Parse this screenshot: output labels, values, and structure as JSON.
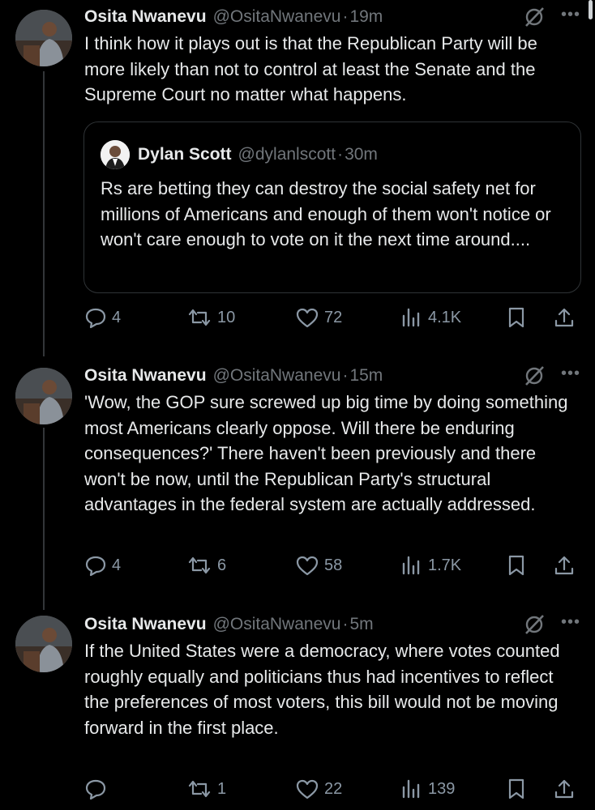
{
  "tweets": [
    {
      "author": "Osita Nwanevu",
      "handle": "@OsitaNwanevu",
      "separator": "·",
      "time": "19m",
      "text": "I think how it plays out is that the Republican Party will be more likely than not to control at least the Senate and the Supreme Court no matter what happens.",
      "quote": {
        "author": "Dylan Scott",
        "handle": "@dylanlscott",
        "separator": "·",
        "time": "30m",
        "text": "Rs are betting they can destroy the social safety net for millions of Americans and enough of them won't notice or won't care enough to vote on it the next time around...."
      },
      "replies": "4",
      "reposts": "10",
      "likes": "72",
      "views": "4.1K"
    },
    {
      "author": "Osita Nwanevu",
      "handle": "@OsitaNwanevu",
      "separator": "·",
      "time": "15m",
      "text": "'Wow, the GOP sure screwed up big time by doing something most Americans clearly oppose. Will there be enduring consequences?' There haven't been previously and there won't be now, until the Republican Party's structural advantages in the federal system are actually addressed.",
      "replies": "4",
      "reposts": "6",
      "likes": "58",
      "views": "1.7K"
    },
    {
      "author": "Osita Nwanevu",
      "handle": "@OsitaNwanevu",
      "separator": "·",
      "time": "5m",
      "text": "If the United States were a democracy, where votes counted roughly equally and politicians thus had incentives to reflect the preferences of most voters, this bill would not be moving forward in the first place.",
      "replies": "",
      "reposts": "1",
      "likes": "22",
      "views": "139"
    }
  ],
  "icons": {
    "more": "•••",
    "grok": "grok-icon",
    "reply": "reply-icon",
    "repost": "repost-icon",
    "like": "heart-icon",
    "views": "views-icon",
    "bookmark": "bookmark-icon",
    "share": "share-icon"
  },
  "colors": {
    "background": "#000000",
    "text": "#e7e9ea",
    "muted": "#71767b",
    "border": "#2f3336"
  }
}
